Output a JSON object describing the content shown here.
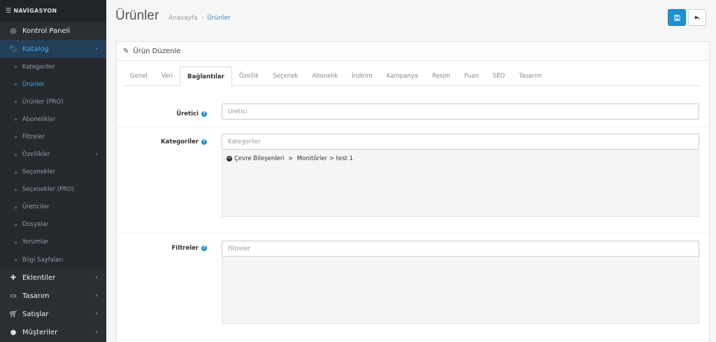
{
  "sidebar": {
    "header": "NAVİGASYON",
    "items_top": [
      {
        "label": "Kontrol Paneli",
        "icon": "dashboard-icon"
      },
      {
        "label": "Katalog",
        "icon": "tags-icon"
      }
    ],
    "submenu": [
      {
        "label": "Kategoriler"
      },
      {
        "label": "Ürünler"
      },
      {
        "label": "Ürünler (PRO)"
      },
      {
        "label": "Abonelikler"
      },
      {
        "label": "Filtreler"
      },
      {
        "label": "Özellikler"
      },
      {
        "label": "Seçenekler"
      },
      {
        "label": "Seçenekler (PRO)"
      },
      {
        "label": "Üreticiler"
      },
      {
        "label": "Dosyalar"
      },
      {
        "label": "Yorumlar"
      },
      {
        "label": "Bilgi Sayfaları"
      }
    ],
    "items_bottom": [
      {
        "label": "Eklentiler",
        "icon": "puzzle-icon"
      },
      {
        "label": "Tasarım",
        "icon": "monitor-icon"
      },
      {
        "label": "Satışlar",
        "icon": "cart-icon"
      },
      {
        "label": "Müşteriler",
        "icon": "user-icon"
      }
    ]
  },
  "header": {
    "title": "Ürünler",
    "breadcrumb": [
      "Anasayfa",
      "Ürünler"
    ]
  },
  "panel": {
    "title": "Ürün Düzenle",
    "tabs": [
      "Genel",
      "Veri",
      "Bağlantılar",
      "Özellik",
      "Seçenek",
      "Abonelik",
      "İndirim",
      "Kampanya",
      "Resim",
      "Puan",
      "SEO",
      "Tasarım"
    ],
    "active_tab": "Bağlantılar"
  },
  "form": {
    "manufacturer": {
      "label": "Üretici",
      "placeholder": "Üretici",
      "value": ""
    },
    "categories": {
      "label": "Kategoriler",
      "placeholder": "Kategoriler",
      "value": "",
      "selected": [
        "Çevre Bileşenleri  >  Monitörler > test 1"
      ]
    },
    "filters": {
      "label": "Filtreler",
      "placeholder": "Filtreler",
      "value": ""
    }
  },
  "colors": {
    "primary": "#1e91cf",
    "sidebar_bg": "#2b2f33",
    "active_link": "#4aa8e4"
  }
}
